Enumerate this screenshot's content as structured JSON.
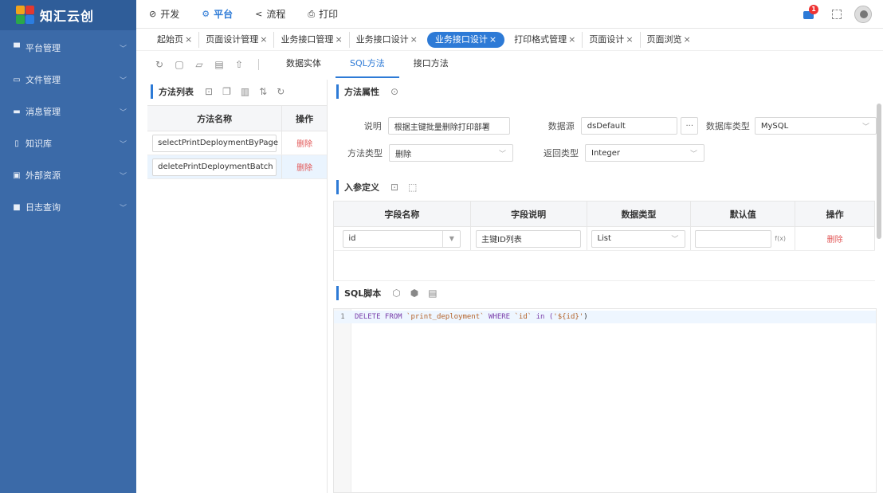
{
  "brand": {
    "name": "知汇云创"
  },
  "sidebar": {
    "items": [
      {
        "label": "平台管理",
        "icon": "monitor-icon"
      },
      {
        "label": "文件管理",
        "icon": "folder-icon"
      },
      {
        "label": "消息管理",
        "icon": "message-icon"
      },
      {
        "label": "知识库",
        "icon": "book-icon"
      },
      {
        "label": "外部资源",
        "icon": "image-icon"
      },
      {
        "label": "日志查询",
        "icon": "log-icon"
      }
    ]
  },
  "topnav": {
    "items": [
      {
        "label": "开发",
        "icon": "code-icon"
      },
      {
        "label": "平台",
        "icon": "gear-icon",
        "active": true
      },
      {
        "label": "流程",
        "icon": "share-icon"
      },
      {
        "label": "打印",
        "icon": "printer-icon"
      }
    ],
    "message_badge": "1"
  },
  "tabs": [
    {
      "label": "起始页"
    },
    {
      "label": "页面设计管理"
    },
    {
      "label": "业务接口管理"
    },
    {
      "label": "业务接口设计"
    },
    {
      "label": "业务接口设计",
      "active": true
    },
    {
      "label": "打印格式管理"
    },
    {
      "label": "页面设计"
    },
    {
      "label": "页面浏览"
    }
  ],
  "tab_close": "×",
  "subtabs": [
    {
      "label": "数据实体"
    },
    {
      "label": "SQL方法",
      "active": true
    },
    {
      "label": "接口方法"
    }
  ],
  "method_list": {
    "title": "方法列表",
    "col_name": "方法名称",
    "col_action": "操作",
    "rows": [
      {
        "name": "selectPrintDeploymentByPage",
        "action": "删除"
      },
      {
        "name": "deletePrintDeploymentBatch",
        "action": "删除",
        "selected": true
      }
    ]
  },
  "method_props": {
    "title": "方法属性",
    "desc_label": "说明",
    "desc_value": "根据主键批量删除打印部署",
    "datasource_label": "数据源",
    "datasource_value": "dsDefault",
    "ellipsis": "···",
    "dbtype_label": "数据库类型",
    "dbtype_value": "MySQL",
    "methodtype_label": "方法类型",
    "methodtype_value": "删除",
    "returntype_label": "返回类型",
    "returntype_value": "Integer"
  },
  "params": {
    "title": "入参定义",
    "headers": [
      "字段名称",
      "字段说明",
      "数据类型",
      "默认值",
      "操作"
    ],
    "rows": [
      {
        "name": "id",
        "desc": "主键ID列表",
        "type": "List",
        "default": "",
        "fx": "f(x)",
        "action": "删除"
      }
    ]
  },
  "sql": {
    "title": "SQL脚本",
    "line_no": "1",
    "kw1": "DELETE FROM ",
    "tbl": "`print_deployment`",
    "kw2": " WHERE ",
    "col": "`id`",
    "kw3": " in (",
    "val": "'${id}'",
    "end": ")"
  }
}
